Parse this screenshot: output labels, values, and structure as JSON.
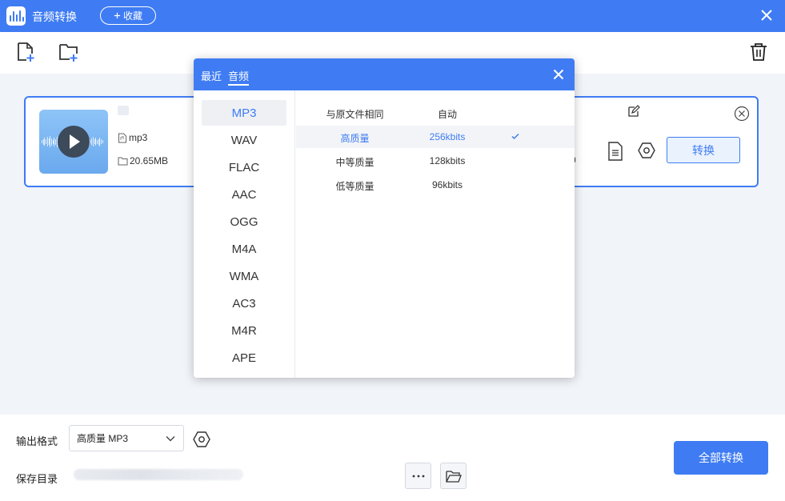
{
  "app": {
    "title": "音频转换",
    "favorite_label": "收藏"
  },
  "file": {
    "format": "mp3",
    "size": "20.65MB",
    "trailing_char": "0",
    "convert_label": "转换"
  },
  "dialog": {
    "tabs": [
      "最近",
      "音频"
    ],
    "active_tab": "音频",
    "formats": [
      "MP3",
      "WAV",
      "FLAC",
      "AAC",
      "OGG",
      "M4A",
      "WMA",
      "AC3",
      "M4R",
      "APE"
    ],
    "selected_format": "MP3",
    "qualities": [
      {
        "name": "与原文件相同",
        "bitrate": "自动"
      },
      {
        "name": "高质量",
        "bitrate": "256kbits",
        "selected": true
      },
      {
        "name": "中等质量",
        "bitrate": "128kbits"
      },
      {
        "name": "低等质量",
        "bitrate": "96kbits"
      }
    ]
  },
  "bottom": {
    "output_format_label": "输出格式",
    "output_format_value": "高质量 MP3",
    "save_dir_label": "保存目录",
    "convert_all_label": "全部转换"
  },
  "colors": {
    "accent": "#3f7cf3",
    "background": "#f1f4f9"
  },
  "icons": [
    "app-logo-icon",
    "plus-icon",
    "close-icon",
    "add-file-icon",
    "add-folder-icon",
    "trash-icon",
    "play-icon",
    "file-icon",
    "folder-icon",
    "edit-icon",
    "remove-circle-icon",
    "document-settings-icon",
    "hexagon-settings-icon",
    "chevron-down-icon",
    "more-icon",
    "check-icon"
  ]
}
